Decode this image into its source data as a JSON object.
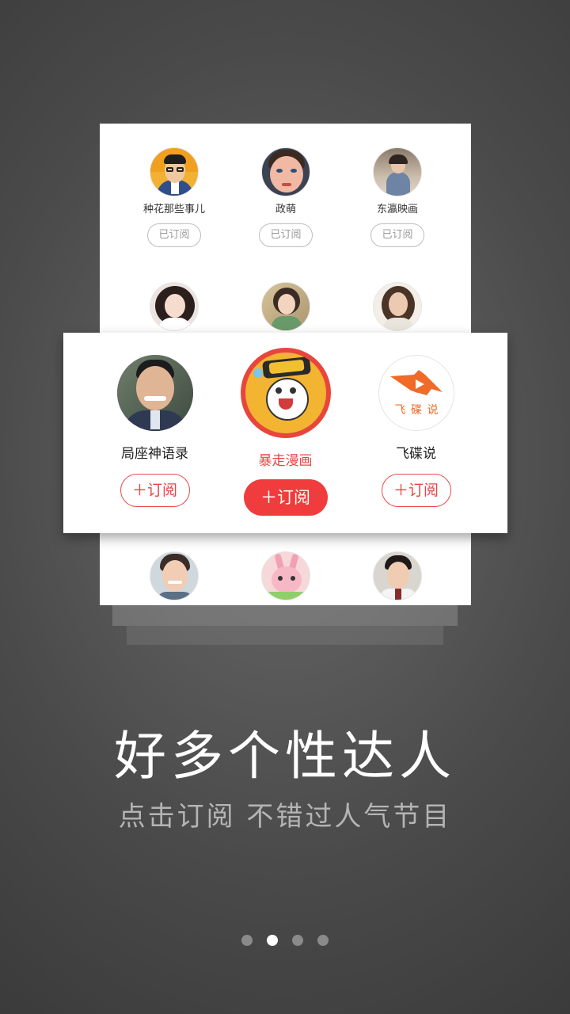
{
  "back_card": {
    "row1": [
      {
        "name": "种花那些事儿",
        "button": "已订阅"
      },
      {
        "name": "政萌",
        "button": "已订阅"
      },
      {
        "name": "东瀛映画",
        "button": "已订阅"
      }
    ]
  },
  "featured": {
    "items": [
      {
        "name": "局座神语录",
        "button": "＋订阅"
      },
      {
        "name": "暴走漫画",
        "button": "＋订阅"
      },
      {
        "name": "飞碟说",
        "button": "＋订阅"
      }
    ],
    "feidie_logo_text": "飞 碟 说"
  },
  "headline": "好多个性达人",
  "subline": "点击订阅   不错过人气节目",
  "pager": {
    "total": 4,
    "active": 2
  },
  "colors": {
    "accent": "#f03c3c",
    "text_primary": "#222222",
    "subscribed_gray": "#9a9a9a"
  },
  "icons": [
    "avatar-zhonghua",
    "avatar-zhengmeng",
    "avatar-dongying",
    "avatar-juzuo",
    "avatar-baozou",
    "avatar-feidie"
  ]
}
